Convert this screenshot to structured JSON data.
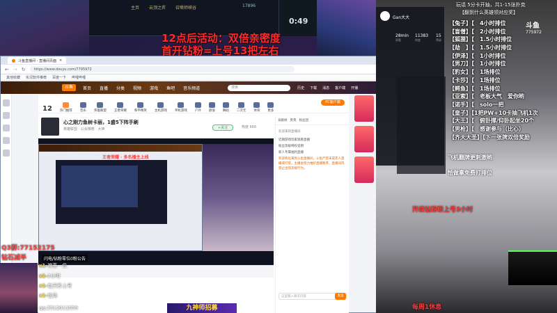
{
  "game": {
    "tabs": [
      "主页",
      "云顶之弈",
      "召唤师峡谷"
    ],
    "stats": "17896",
    "timer": "0:49"
  },
  "event": {
    "line1": "12点后活动：双倍亲密度",
    "line2": "首开钻粉=上号13把左右"
  },
  "browser": {
    "tab_title": "斗鱼直播间 - 直播间页面",
    "url": "https://www.douyu.com/7795972",
    "bookmarks": [
      "其他收藏",
      "实况软件推荐",
      "百度一下",
      "哔哩哔哩"
    ]
  },
  "douyu": {
    "logo": "斗鱼",
    "nav": [
      "首页",
      "直播",
      "分类",
      "视频",
      "游戏",
      "鱼吧",
      "音乐频道"
    ],
    "search_placeholder": "搜索",
    "right_items": [
      "历史",
      "下载",
      "消息",
      "客户端",
      "开播"
    ],
    "categories": [
      "12",
      "热门推荐",
      "音乐",
      "英雄联盟",
      "王者荣耀",
      "和平精英",
      "主机游戏",
      "单机游戏",
      "户外",
      "颜值",
      "舞蹈",
      "二次元",
      "体育",
      "更多"
    ],
    "pc_button": "PC客户端",
    "room_title": "心之刚力鱼树卡丽，1盛5下阵手刷",
    "room_sub": "英雄联盟 · 公会推荐 · 大神",
    "follow": "+关注",
    "hot": "热度 666"
  },
  "player": {
    "overlay_text": "王者荣耀 · 多名播主上线"
  },
  "chat": {
    "tabs": [
      "贡献榜",
      "贵宾",
      "粉丝团"
    ],
    "notice": "欢迎来到直播间",
    "messages": [
      "近期游戏玩家观看直播",
      "粉丝等级特权说明",
      "新人专属福利直播"
    ],
    "orange": "欢迎各位来到斗鱼直播间，斗鱼严禁未成年人直播或打赏。主播会努力维护直播秩序，直播间内禁止出现违规行为。",
    "send_placeholder": "这里输入聊天内容",
    "send_button": "发送"
  },
  "banner": {
    "bottom_text": "九神师招募"
  },
  "left_overlay": {
    "qq": "Q3群:77152175",
    "diamond": "钻石减半",
    "fans_note": "闪电/钻粉零位0粉公告",
    "ranks": [
      {
        "label": "x1-",
        "value": "神豪一位"
      },
      {
        "label": "x1-",
        "value": "2小时"
      },
      {
        "label": "x1-",
        "value": "包天秒上号"
      },
      {
        "label": "x1-",
        "value": "包场"
      }
    ],
    "qq2": "qq:2512011059"
  },
  "streamer_card": {
    "name": "Gan大大",
    "stats": [
      {
        "label": "28min",
        "value": "观看"
      },
      {
        "label": "11383",
        "value": "热度"
      },
      {
        "label": "15",
        "value": "等级"
      }
    ]
  },
  "right_overlay": {
    "title": "玩话 5分卡开抽，共1-15张扑克",
    "sub": "【翻到什么英雄领对应奖】",
    "logo_text": "斗鱼",
    "room_no": "775972",
    "list": [
      "【兔子】【　4小时排位",
      "【盲僧】【　2小时排位",
      "【狐狸】【　1.5小时排位",
      "【劫　】【　1.5小时排位",
      "【伊泽】【　1小时排位",
      "【男刀】【　1小时排位",
      "【豹女】【　1场排位",
      "【卡莎】【　1场排位",
      "【鳄鱼】【　1场排位",
      "【亚索】【　老板大气　爱你哟",
      "【诺手】【　solo一把",
      "【皇子】【1把PW+10卡抽飞机1次",
      "【大王】【　俯卧撑/仰卧起坐20个",
      "【男枪】【　感谢参与（比心）",
      "【齐天大圣】【下一张牌双倍奖励"
    ],
    "plane": "飞机翻牌更刺激哟",
    "gift": "恰做拿免费打排位",
    "diamond": "开续钻粉粉上号3小时",
    "rest": "每周1休息"
  }
}
